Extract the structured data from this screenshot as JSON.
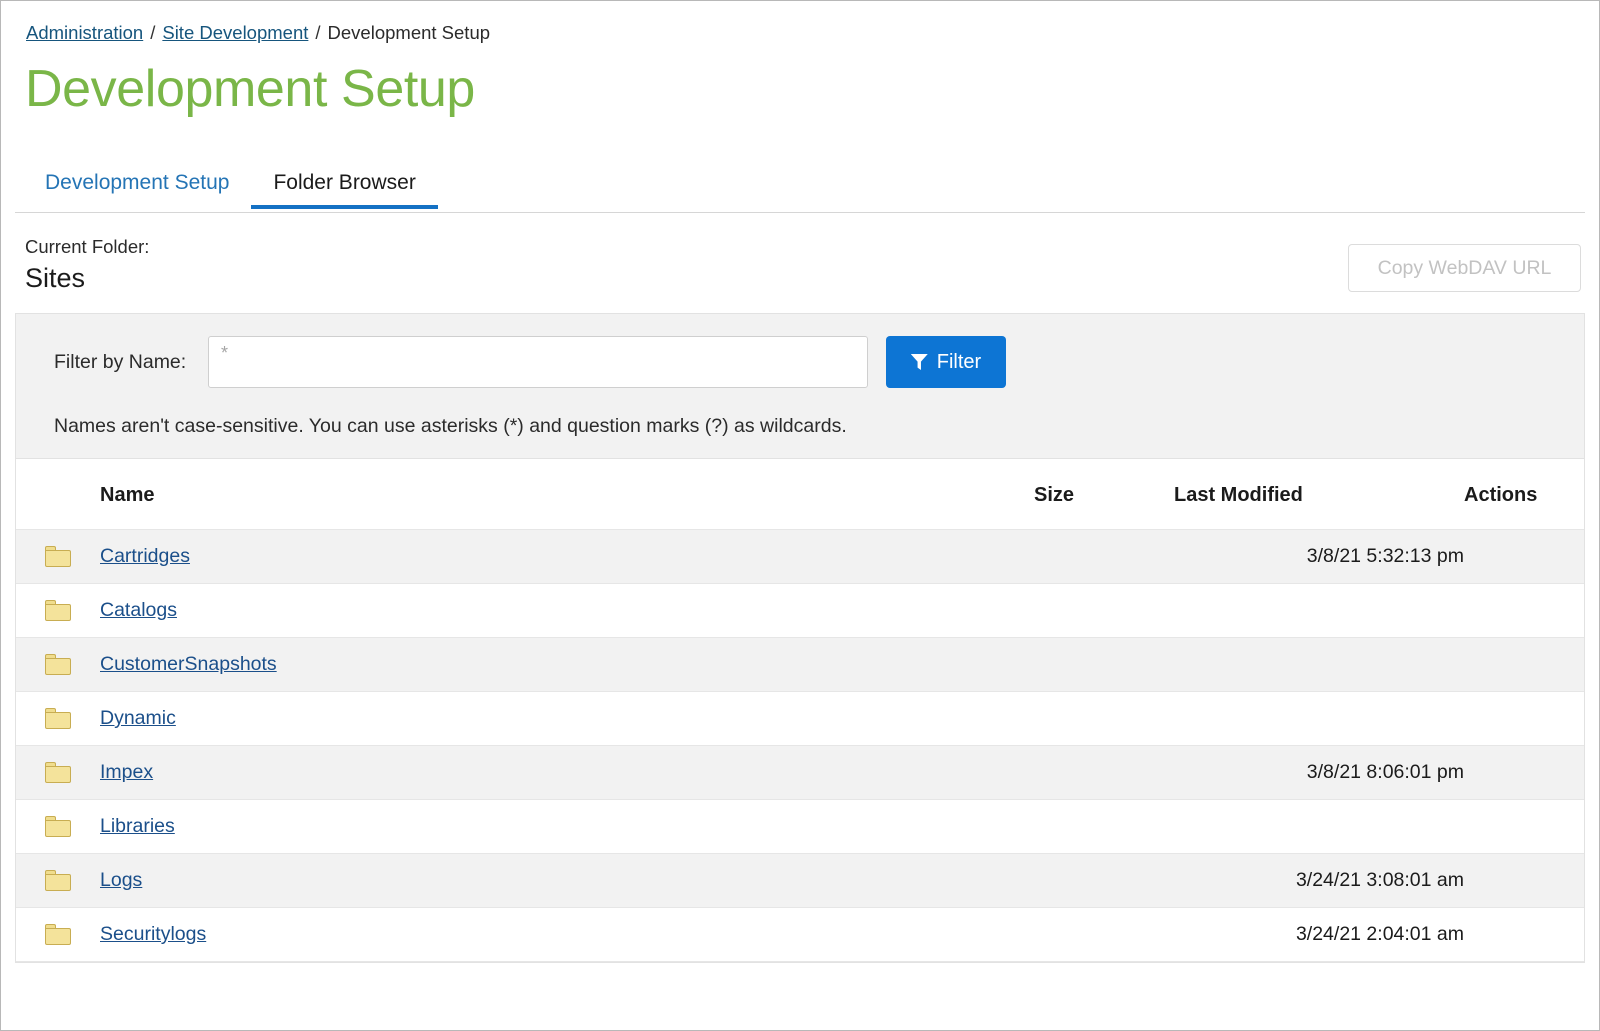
{
  "breadcrumb": {
    "items": [
      {
        "label": "Administration",
        "link": true
      },
      {
        "label": "Site Development",
        "link": true
      },
      {
        "label": "Development Setup",
        "link": false
      }
    ],
    "separator": "/"
  },
  "header": {
    "title": "Development Setup",
    "title_color": "#7ab648"
  },
  "tabs": [
    {
      "label": "Development Setup",
      "active": false
    },
    {
      "label": "Folder Browser",
      "active": true
    }
  ],
  "folder": {
    "label": "Current Folder:",
    "value": "Sites",
    "webdav_button": "Copy WebDAV URL",
    "webdav_disabled": true
  },
  "filter": {
    "label": "Filter by Name:",
    "input_value": "",
    "input_placeholder": "*",
    "button_label": "Filter",
    "button_icon": "funnel-icon",
    "button_color": "#0d75d4",
    "hint": "Names aren't case-sensitive. You can use asterisks (*) and question marks (?) as wildcards."
  },
  "table": {
    "columns": [
      "Name",
      "Size",
      "Last Modified",
      "Actions"
    ],
    "rows": [
      {
        "icon": "folder-icon",
        "name": "Cartridges",
        "size": "",
        "modified": "3/8/21 5:32:13 pm",
        "actions": ""
      },
      {
        "icon": "folder-icon",
        "name": "Catalogs",
        "size": "",
        "modified": "",
        "actions": ""
      },
      {
        "icon": "folder-icon",
        "name": "CustomerSnapshots",
        "size": "",
        "modified": "",
        "actions": ""
      },
      {
        "icon": "folder-icon",
        "name": "Dynamic",
        "size": "",
        "modified": "",
        "actions": ""
      },
      {
        "icon": "folder-icon",
        "name": "Impex",
        "size": "",
        "modified": "3/8/21 8:06:01 pm",
        "actions": ""
      },
      {
        "icon": "folder-icon",
        "name": "Libraries",
        "size": "",
        "modified": "",
        "actions": ""
      },
      {
        "icon": "folder-icon",
        "name": "Logs",
        "size": "",
        "modified": "3/24/21 3:08:01 am",
        "actions": ""
      },
      {
        "icon": "folder-icon",
        "name": "Securitylogs",
        "size": "",
        "modified": "3/24/21 2:04:01 am",
        "actions": ""
      }
    ]
  }
}
